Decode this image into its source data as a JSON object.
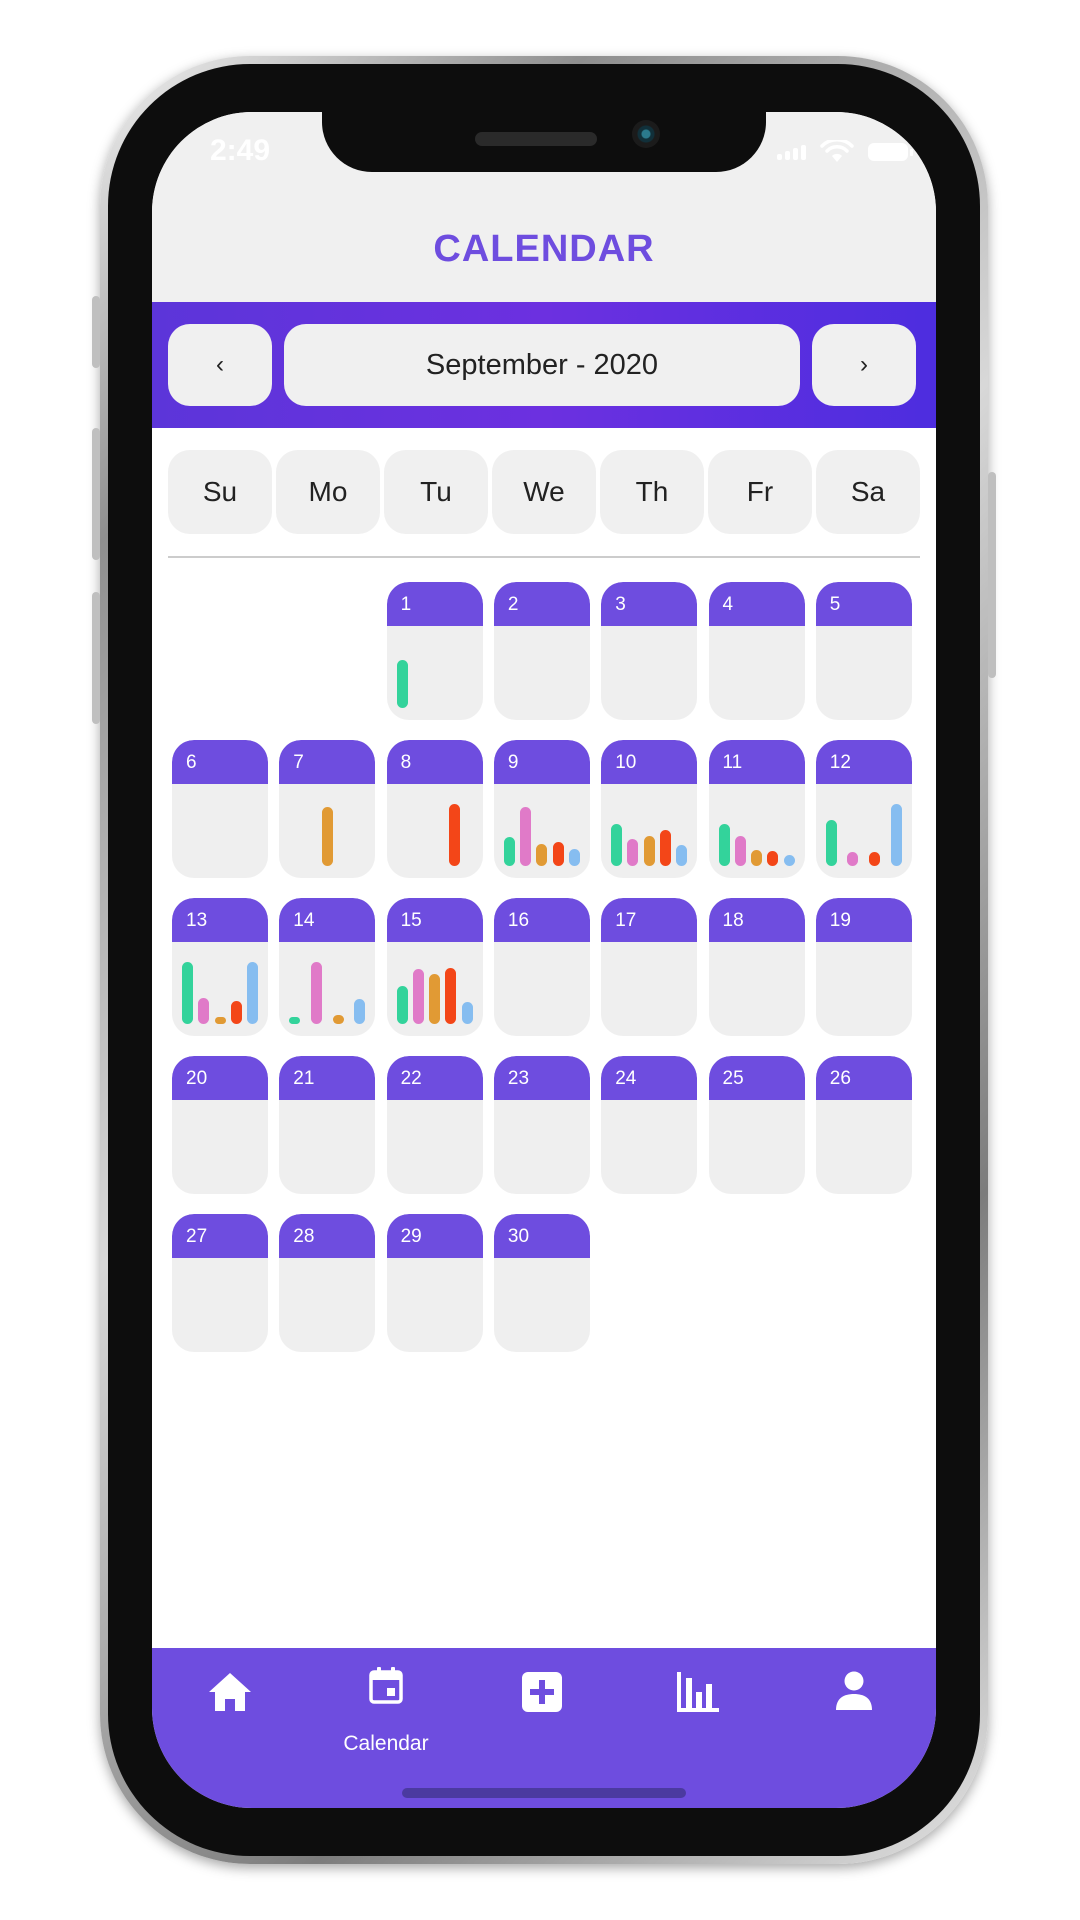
{
  "status": {
    "time": "2:49"
  },
  "header": {
    "title": "CALENDAR"
  },
  "month_nav": {
    "prev_label": "‹",
    "month_label": "September - 2020",
    "next_label": "›"
  },
  "weekdays": [
    "Su",
    "Mo",
    "Tu",
    "We",
    "Th",
    "Fr",
    "Sa"
  ],
  "colors": {
    "accent": "#6e4ddf",
    "green": "#33d39b",
    "pink": "#e07ac8",
    "orange": "#e19a34",
    "red": "#f34618",
    "blue": "#86bdf0"
  },
  "calendar": {
    "first_weekday_index": 2,
    "days": [
      {
        "day": "1",
        "bars": [
          {
            "color": "green",
            "value": 0.78
          }
        ]
      },
      {
        "day": "2",
        "bars": []
      },
      {
        "day": "3",
        "bars": []
      },
      {
        "day": "4",
        "bars": []
      },
      {
        "day": "5",
        "bars": []
      },
      {
        "day": "6",
        "bars": []
      },
      {
        "day": "7",
        "bars": [
          {
            "color": "orange",
            "value": 0.95
          }
        ]
      },
      {
        "day": "8",
        "bars": [
          {
            "color": "red",
            "value": 1.0
          }
        ]
      },
      {
        "day": "9",
        "bars": [
          {
            "color": "green",
            "value": 0.46
          },
          {
            "color": "pink",
            "value": 0.95
          },
          {
            "color": "orange",
            "value": 0.35
          },
          {
            "color": "red",
            "value": 0.38
          },
          {
            "color": "blue",
            "value": 0.27
          }
        ]
      },
      {
        "day": "10",
        "bars": [
          {
            "color": "green",
            "value": 0.68
          },
          {
            "color": "pink",
            "value": 0.44
          },
          {
            "color": "orange",
            "value": 0.49
          },
          {
            "color": "red",
            "value": 0.58
          },
          {
            "color": "blue",
            "value": 0.34
          }
        ]
      },
      {
        "day": "11",
        "bars": [
          {
            "color": "green",
            "value": 0.68
          },
          {
            "color": "pink",
            "value": 0.48
          },
          {
            "color": "orange",
            "value": 0.26
          },
          {
            "color": "red",
            "value": 0.24
          },
          {
            "color": "blue",
            "value": 0.18
          }
        ]
      },
      {
        "day": "12",
        "bars": [
          {
            "color": "green",
            "value": 0.74
          },
          {
            "color": "pink",
            "value": 0.22
          },
          {
            "color": "red",
            "value": 0.22
          },
          {
            "color": "blue",
            "value": 1.0
          }
        ]
      },
      {
        "day": "13",
        "bars": [
          {
            "color": "green",
            "value": 1.0
          },
          {
            "color": "pink",
            "value": 0.42
          },
          {
            "color": "orange",
            "value": 0.06
          },
          {
            "color": "red",
            "value": 0.37
          },
          {
            "color": "blue",
            "value": 1.0
          }
        ]
      },
      {
        "day": "14",
        "bars": [
          {
            "color": "green",
            "value": 0.12
          },
          {
            "color": "pink",
            "value": 1.0
          },
          {
            "color": "orange",
            "value": 0.14
          },
          {
            "color": "blue",
            "value": 0.4
          }
        ]
      },
      {
        "day": "15",
        "bars": [
          {
            "color": "green",
            "value": 0.62
          },
          {
            "color": "pink",
            "value": 0.88
          },
          {
            "color": "orange",
            "value": 0.8
          },
          {
            "color": "red",
            "value": 0.9
          },
          {
            "color": "blue",
            "value": 0.36
          }
        ]
      },
      {
        "day": "16",
        "bars": []
      },
      {
        "day": "17",
        "bars": []
      },
      {
        "day": "18",
        "bars": []
      },
      {
        "day": "19",
        "bars": []
      },
      {
        "day": "20",
        "bars": []
      },
      {
        "day": "21",
        "bars": []
      },
      {
        "day": "22",
        "bars": []
      },
      {
        "day": "23",
        "bars": []
      },
      {
        "day": "24",
        "bars": []
      },
      {
        "day": "25",
        "bars": []
      },
      {
        "day": "26",
        "bars": []
      },
      {
        "day": "27",
        "bars": []
      },
      {
        "day": "28",
        "bars": []
      },
      {
        "day": "29",
        "bars": []
      },
      {
        "day": "30",
        "bars": []
      }
    ]
  },
  "tabs": [
    {
      "name": "tab-home",
      "icon": "home-icon",
      "label": ""
    },
    {
      "name": "tab-calendar",
      "icon": "calendar-icon",
      "label": "Calendar"
    },
    {
      "name": "tab-add",
      "icon": "add-square-icon",
      "label": ""
    },
    {
      "name": "tab-stats",
      "icon": "bar-chart-icon",
      "label": ""
    },
    {
      "name": "tab-profile",
      "icon": "person-icon",
      "label": ""
    }
  ]
}
